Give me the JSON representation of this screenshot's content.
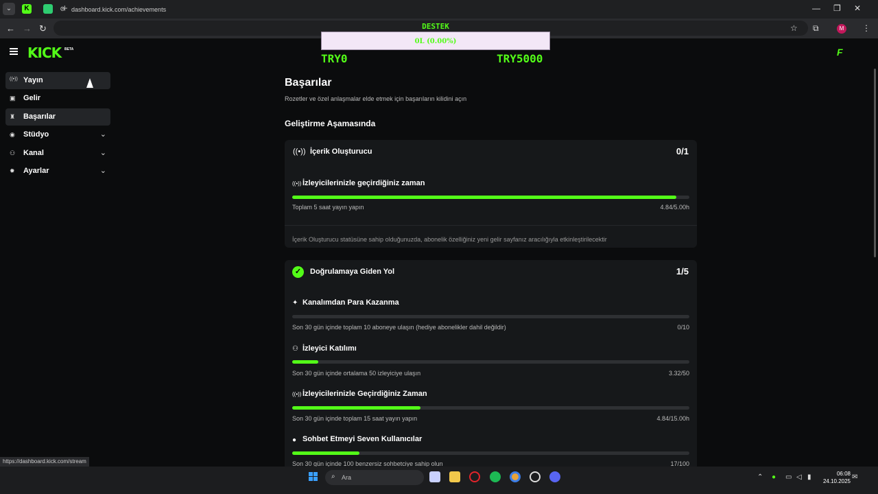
{
  "browser": {
    "url": "dashboard.kick.com/achievements",
    "status_url": "https://dashboard.kick.com/stream",
    "profile_initial": "M"
  },
  "overlay": {
    "title": "DESTEK",
    "progress_text": "0L (0.00%)",
    "progress_fraction": 0,
    "min_label": "TRY0",
    "max_label": "TRY5000"
  },
  "header": {
    "logo": "KICK",
    "beta": "BETA"
  },
  "sidebar": {
    "items": [
      {
        "label": "Yayın",
        "icon": "broadcast-icon",
        "expandable": false
      },
      {
        "label": "Gelir",
        "icon": "wallet-icon",
        "expandable": false
      },
      {
        "label": "Başarılar",
        "icon": "trophy-icon",
        "expandable": false
      },
      {
        "label": "Stüdyo",
        "icon": "studio-icon",
        "expandable": true
      },
      {
        "label": "Kanal",
        "icon": "users-icon",
        "expandable": true
      },
      {
        "label": "Ayarlar",
        "icon": "gear-icon",
        "expandable": true
      }
    ]
  },
  "main": {
    "title": "Başarılar",
    "subtitle": "Rozetler ve özel anlaşmalar elde etmek için başarıların kilidini açın",
    "section_title": "Geliştirme Aşamasında",
    "cards": [
      {
        "title": "İçerik Oluşturucu",
        "count": "0/1",
        "icon": "broadcast-icon",
        "requirements": [
          {
            "title": "İzleyicilerinizle geçirdiğiniz zaman",
            "desc": "Toplam 5 saat yayın yapın",
            "value": "4.84/5.00h",
            "progress": 0.968,
            "icon": "broadcast-icon"
          }
        ],
        "note": "İçerik Oluşturucu statüsüne sahip olduğunuzda, abonelik özelliğiniz yeni gelir sayfanız aracılığıyla etkinleştirilecektir"
      },
      {
        "title": "Doğrulamaya Giden Yol",
        "count": "1/5",
        "icon": "verified-icon",
        "requirements": [
          {
            "title": "Kanalımdan Para Kazanma",
            "desc": "Son 30 gün içinde toplam 10 aboneye ulaşın (hediye abonelikler dahil değildir)",
            "value": "0/10",
            "progress": 0,
            "icon": "sparkle-icon"
          },
          {
            "title": "İzleyici Katılımı",
            "desc": "Son 30 gün içinde ortalama 50 izleyiciye ulaşın",
            "value": "3.32/50",
            "progress": 0.0664,
            "icon": "viewers-icon"
          },
          {
            "title": "İzleyicilerinizle Geçirdiğiniz Zaman",
            "desc": "Son 30 gün içinde toplam 15 saat yayın yapın",
            "value": "4.84/15.00h",
            "progress": 0.3227,
            "icon": "broadcast-icon"
          },
          {
            "title": "Sohbet Etmeyi Seven Kullanıcılar",
            "desc": "Son 30 gün içinde 100 benzersiz sohbetciye sahip olun",
            "value": "17/100",
            "progress": 0.17,
            "icon": "chat-icon"
          }
        ]
      }
    ]
  },
  "taskbar": {
    "search_label": "Ara",
    "time": "06:08",
    "date": "24.10.2025"
  },
  "colors": {
    "accent": "#53fc18",
    "background": "#0b0c0d",
    "card": "#16181a"
  }
}
